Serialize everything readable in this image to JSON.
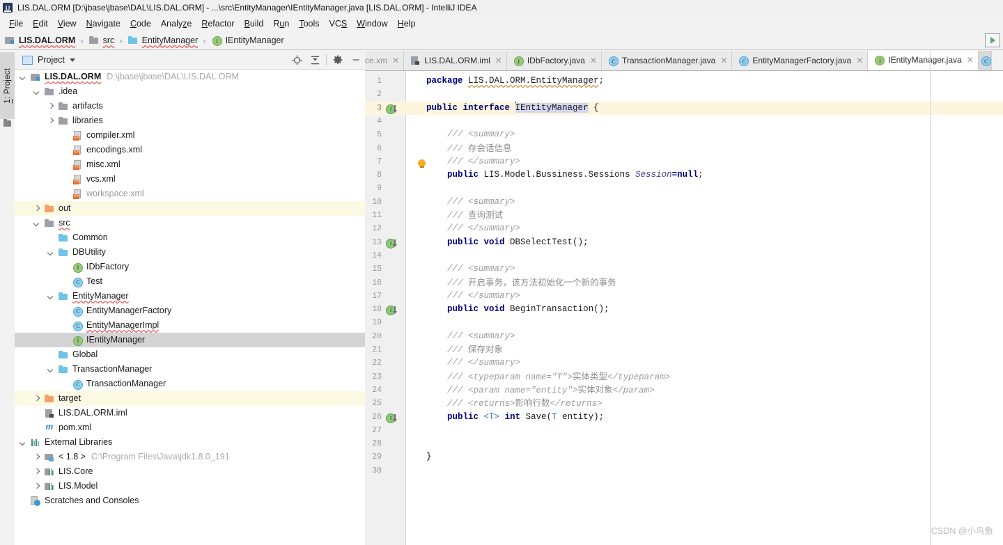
{
  "window": {
    "title": "LIS.DAL.ORM [D:\\jbase\\jbase\\DAL\\LIS.DAL.ORM] - ...\\src\\EntityManager\\IEntityManager.java [LIS.DAL.ORM] - IntelliJ IDEA",
    "logo_icon": "intellij-idea-logo"
  },
  "menubar": {
    "items": [
      {
        "label": "File",
        "mnemonic": "F"
      },
      {
        "label": "Edit",
        "mnemonic": "E"
      },
      {
        "label": "View",
        "mnemonic": "V"
      },
      {
        "label": "Navigate",
        "mnemonic": "N"
      },
      {
        "label": "Code",
        "mnemonic": "C"
      },
      {
        "label": "Analyze",
        "mnemonic": "z"
      },
      {
        "label": "Refactor",
        "mnemonic": "R"
      },
      {
        "label": "Build",
        "mnemonic": "B"
      },
      {
        "label": "Run",
        "mnemonic": "u"
      },
      {
        "label": "Tools",
        "mnemonic": "T"
      },
      {
        "label": "VCS",
        "mnemonic": "S"
      },
      {
        "label": "Window",
        "mnemonic": "W"
      },
      {
        "label": "Help",
        "mnemonic": "H"
      }
    ]
  },
  "navbar": {
    "crumbs": [
      {
        "label": "LIS.DAL.ORM",
        "icon": "module-icon",
        "bold": true,
        "squiggly": true
      },
      {
        "label": "src",
        "icon": "folder-gray-icon",
        "bold": false,
        "squiggly": true
      },
      {
        "label": "EntityManager",
        "icon": "folder-blue-icon",
        "bold": false,
        "squiggly": true
      },
      {
        "label": "IEntityManager",
        "icon": "interface-icon",
        "bold": false,
        "squiggly": false
      }
    ],
    "separator": "›",
    "right_button_icon": "run-configuration-icon"
  },
  "left_rail": {
    "tab_label": "1: Project",
    "tab_mnemonic": "1",
    "folder_icon": "folder-icon"
  },
  "project_panel": {
    "title": "Project",
    "dropdown_icon": "chevron-down-icon",
    "window_icon": "project-view-icon",
    "tools": [
      {
        "icon": "locate-target-icon",
        "name": "select-opened-file"
      },
      {
        "icon": "collapse-all-icon",
        "name": "collapse-all"
      },
      {
        "icon": "gear-icon",
        "name": "settings"
      },
      {
        "icon": "minimize-icon",
        "name": "hide"
      }
    ],
    "tree": [
      {
        "indent": 0,
        "twisty": "down",
        "icon": "module-icon",
        "label": "LIS.DAL.ORM",
        "bold": true,
        "squiggly": true,
        "hint": "D:\\jbase\\jbase\\DAL\\LIS.DAL.ORM",
        "state": "normal"
      },
      {
        "indent": 1,
        "twisty": "down",
        "icon": "folder-gray-icon",
        "label": ".idea",
        "state": "normal"
      },
      {
        "indent": 2,
        "twisty": "right",
        "icon": "folder-gray-icon",
        "label": "artifacts",
        "state": "normal"
      },
      {
        "indent": 2,
        "twisty": "right",
        "icon": "folder-gray-icon",
        "label": "libraries",
        "state": "normal"
      },
      {
        "indent": 3,
        "twisty": "none",
        "icon": "xml-file-icon",
        "label": "compiler.xml",
        "state": "normal"
      },
      {
        "indent": 3,
        "twisty": "none",
        "icon": "xml-file-icon",
        "label": "encodings.xml",
        "state": "normal"
      },
      {
        "indent": 3,
        "twisty": "none",
        "icon": "xml-file-icon",
        "label": "misc.xml",
        "state": "normal"
      },
      {
        "indent": 3,
        "twisty": "none",
        "icon": "xml-file-icon",
        "label": "vcs.xml",
        "state": "normal"
      },
      {
        "indent": 3,
        "twisty": "none",
        "icon": "xml-file-icon",
        "label": "workspace.xml",
        "gray": true,
        "state": "normal"
      },
      {
        "indent": 1,
        "twisty": "right",
        "icon": "folder-orange-icon",
        "label": "out",
        "state": "yellow"
      },
      {
        "indent": 1,
        "twisty": "down",
        "icon": "folder-gray-icon",
        "label": "src",
        "squiggly": true,
        "state": "normal"
      },
      {
        "indent": 2,
        "twisty": "none",
        "icon": "folder-blue-icon",
        "label": "Common",
        "state": "normal"
      },
      {
        "indent": 2,
        "twisty": "down",
        "icon": "folder-blue-icon",
        "label": "DBUtility",
        "state": "normal"
      },
      {
        "indent": 3,
        "twisty": "none",
        "icon": "interface-icon",
        "label": "IDbFactory",
        "state": "normal"
      },
      {
        "indent": 3,
        "twisty": "none",
        "icon": "class-icon",
        "label": "Test",
        "state": "normal"
      },
      {
        "indent": 2,
        "twisty": "down",
        "icon": "folder-blue-icon",
        "label": "EntityManager",
        "squiggly": true,
        "state": "normal"
      },
      {
        "indent": 3,
        "twisty": "none",
        "icon": "class-icon",
        "label": "EntityManagerFactory",
        "state": "normal"
      },
      {
        "indent": 3,
        "twisty": "none",
        "icon": "class-icon",
        "label": "EntityManagerImpl",
        "squiggly": true,
        "state": "normal"
      },
      {
        "indent": 3,
        "twisty": "none",
        "icon": "interface-icon",
        "label": "IEntityManager",
        "state": "selected"
      },
      {
        "indent": 2,
        "twisty": "none",
        "icon": "folder-blue-icon",
        "label": "Global",
        "state": "normal"
      },
      {
        "indent": 2,
        "twisty": "down",
        "icon": "folder-blue-icon",
        "label": "TransactionManager",
        "state": "normal"
      },
      {
        "indent": 3,
        "twisty": "none",
        "icon": "class-icon",
        "label": "TransactionManager",
        "state": "normal"
      },
      {
        "indent": 1,
        "twisty": "right",
        "icon": "folder-orange-icon",
        "label": "target",
        "state": "yellow"
      },
      {
        "indent": 1,
        "twisty": "none",
        "icon": "iml-file-icon",
        "label": "LIS.DAL.ORM.iml",
        "state": "normal"
      },
      {
        "indent": 1,
        "twisty": "none",
        "icon": "maven-file-icon",
        "label": "pom.xml",
        "state": "normal"
      },
      {
        "indent": 0,
        "twisty": "down",
        "icon": "external-libraries-icon",
        "label": "External Libraries",
        "state": "normal"
      },
      {
        "indent": 1,
        "twisty": "right",
        "icon": "jdk-icon",
        "label": "< 1.8 >",
        "hint": "C:\\Program Files\\Java\\jdk1.8.0_191",
        "state": "normal"
      },
      {
        "indent": 1,
        "twisty": "right",
        "icon": "library-icon",
        "label": "LIS.Core",
        "state": "normal"
      },
      {
        "indent": 1,
        "twisty": "right",
        "icon": "library-icon",
        "label": "LIS.Model",
        "state": "normal"
      },
      {
        "indent": 0,
        "twisty": "none",
        "icon": "scratches-icon",
        "label": "Scratches and Consoles",
        "state": "normal"
      }
    ]
  },
  "editor": {
    "tabs": [
      {
        "label": "ce.xm",
        "icon": "none",
        "active": false,
        "clipped": true
      },
      {
        "label": "LIS.DAL.ORM.iml",
        "icon": "iml-file-icon",
        "active": false
      },
      {
        "label": "IDbFactory.java",
        "icon": "interface-icon",
        "active": false
      },
      {
        "label": "TransactionManager.java",
        "icon": "class-icon",
        "active": false
      },
      {
        "label": "EntityManagerFactory.java",
        "icon": "class-icon",
        "active": false
      },
      {
        "label": "IEntityManager.java",
        "icon": "interface-icon",
        "active": true
      }
    ],
    "close_icon": "close-icon",
    "line_count": 30,
    "highlight_line": 3,
    "gutter_marks": [
      {
        "line": 3,
        "icon": "implemented-interface-icon"
      },
      {
        "line": 13,
        "icon": "implemented-method-icon"
      },
      {
        "line": 18,
        "icon": "implemented-method-icon"
      },
      {
        "line": 26,
        "icon": "implemented-method-icon"
      }
    ],
    "intention_bulb": {
      "line": 2,
      "icon": "lightbulb-icon"
    },
    "lines": [
      {
        "n": 1,
        "html": "<span class=\"kw\">package</span> <span class=\"plain pkg-squig\">LIS.DAL.ORM.EntityManager</span><span class=\"plain\">;</span>"
      },
      {
        "n": 2,
        "html": ""
      },
      {
        "n": 3,
        "html": "<span class=\"kw\">public interface</span> <span class=\"caret\"></span><span class=\"sel ident\">IEntityManager</span> <span class=\"plain\">{</span>"
      },
      {
        "n": 4,
        "html": ""
      },
      {
        "n": 5,
        "html": "    <span class=\"cmt\">/// &lt;summary&gt;</span>"
      },
      {
        "n": 6,
        "html": "    <span class=\"cmt\">/// </span><span class=\"cmt-cn\">存会话信息</span>"
      },
      {
        "n": 7,
        "html": "    <span class=\"cmt\">/// &lt;/summary&gt;</span>"
      },
      {
        "n": 8,
        "html": "    <span class=\"kw\">public</span> <span class=\"plain\">LIS.Model.Bussiness.Sessions</span> <span class=\"field\">Session</span><span class=\"kw\">=null</span><span class=\"plain\">;</span>"
      },
      {
        "n": 9,
        "html": ""
      },
      {
        "n": 10,
        "html": "    <span class=\"cmt\">/// &lt;summary&gt;</span>"
      },
      {
        "n": 11,
        "html": "    <span class=\"cmt\">/// </span><span class=\"cmt-cn\">查询测试</span>"
      },
      {
        "n": 12,
        "html": "    <span class=\"cmt\">/// &lt;/summary&gt;</span>"
      },
      {
        "n": 13,
        "html": "    <span class=\"kw\">public void</span> <span class=\"plain\">DBSelectTest();</span>"
      },
      {
        "n": 14,
        "html": ""
      },
      {
        "n": 15,
        "html": "    <span class=\"cmt\">/// &lt;summary&gt;</span>"
      },
      {
        "n": 16,
        "html": "    <span class=\"cmt\">/// </span><span class=\"cmt-cn\">开启事务，该方法初始化一个新的事务</span>"
      },
      {
        "n": 17,
        "html": "    <span class=\"cmt\">/// &lt;/summary&gt;</span>"
      },
      {
        "n": 18,
        "html": "    <span class=\"kw\">public void</span> <span class=\"plain\">BeginTransaction();</span>"
      },
      {
        "n": 19,
        "html": ""
      },
      {
        "n": 20,
        "html": "    <span class=\"cmt\">/// &lt;summary&gt;</span>"
      },
      {
        "n": 21,
        "html": "    <span class=\"cmt\">/// </span><span class=\"cmt-cn\">保存对象</span>"
      },
      {
        "n": 22,
        "html": "    <span class=\"cmt\">/// &lt;/summary&gt;</span>"
      },
      {
        "n": 23,
        "html": "    <span class=\"cmt\">/// &lt;typeparam name=\"T\"&gt;</span><span class=\"cmt-cn\">实体类型</span><span class=\"cmt\">&lt;/typeparam&gt;</span>"
      },
      {
        "n": 24,
        "html": "    <span class=\"cmt\">/// &lt;param name=\"entity\"&gt;</span><span class=\"cmt-cn\">实体对象</span><span class=\"cmt\">&lt;/param&gt;</span>"
      },
      {
        "n": 25,
        "html": "    <span class=\"cmt\">/// &lt;returns&gt;</span><span class=\"cmt-cn\">影响行数</span><span class=\"cmt\">&lt;/returns&gt;</span>"
      },
      {
        "n": 26,
        "html": "    <span class=\"kw\">public</span> <span class=\"tparam\">&lt;T&gt;</span> <span class=\"kw\">int</span> <span class=\"plain\">Save(</span><span class=\"tparam\">T</span> <span class=\"plain\">entity);</span>"
      },
      {
        "n": 27,
        "html": ""
      },
      {
        "n": 28,
        "html": ""
      },
      {
        "n": 29,
        "html": "<span class=\"plain\">}</span>"
      },
      {
        "n": 30,
        "html": ""
      }
    ]
  },
  "watermark": {
    "text": "CSDN @小鸟鱼"
  },
  "colors": {
    "accent_selection": "#d4d4f0",
    "highlight_line": "#fdf6dd",
    "tree_selected": "#d4d4d4",
    "tree_yellow": "#fdfae4",
    "keyword": "#00007f",
    "comment": "#9b9b9b",
    "interface_icon": "#98ca7a",
    "class_icon": "#8fd1ef",
    "folder_blue": "#6fc3e8",
    "folder_orange": "#f4a26c"
  }
}
